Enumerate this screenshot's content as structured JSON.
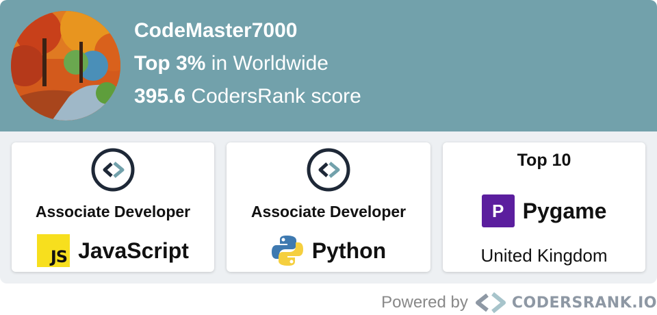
{
  "profile": {
    "username": "CodeMaster7000",
    "rank_value": "Top 3%",
    "rank_region": "in Worldwide",
    "score_value": "395.6",
    "score_label": "CodersRank score"
  },
  "badges": [
    {
      "title": "Associate Developer",
      "tech": "JavaScript",
      "icon": "javascript-icon"
    },
    {
      "title": "Associate Developer",
      "tech": "Python",
      "icon": "python-icon"
    }
  ],
  "ranking": {
    "title": "Top 10",
    "tech": "Pygame",
    "tech_icon_letter": "P",
    "country": "United Kingdom"
  },
  "footer": {
    "powered_by": "Powered by",
    "brand": "CODERSRANK.IO"
  },
  "colors": {
    "header_bg": "#72a1ab",
    "panel_bg": "#edf0f3",
    "js_yellow": "#f7df1e",
    "pygame_purple": "#5b1e9e",
    "logo_teal": "#72a1ab",
    "logo_navy": "#1e2837"
  }
}
